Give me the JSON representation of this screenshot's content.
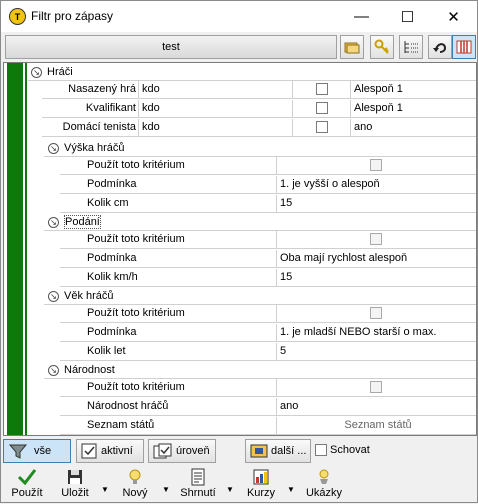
{
  "window": {
    "title": "Filtr pro zápasy",
    "minimize": "—",
    "maximize": "☐",
    "close": "✕"
  },
  "toolbar": {
    "filter_name": "test"
  },
  "grid": {
    "group_players": "Hráči",
    "rows_players": [
      {
        "label": "Nasazený hrá",
        "who": "kdo",
        "value": "Alespoň 1"
      },
      {
        "label": "Kvalifikant",
        "who": "kdo",
        "value": "Alespoň 1"
      },
      {
        "label": "Domácí tenista",
        "who": "kdo",
        "value": "ano"
      }
    ],
    "group_height": {
      "title": "Výška hráčů",
      "use_label": "Použít toto kritérium",
      "cond_label": "Podmínka",
      "cond_value": "1. je vyšší o alespoň",
      "count_label": "Kolik cm",
      "count_value": "15"
    },
    "group_serve": {
      "title": "Podání",
      "use_label": "Použít toto kritérium",
      "cond_label": "Podmínka",
      "cond_value": "Oba mají rychlost alespoň",
      "count_label": "Kolik km/h",
      "count_value": "15"
    },
    "group_age": {
      "title": "Věk hráčů",
      "use_label": "Použít toto kritérium",
      "cond_label": "Podmínka",
      "cond_value": "1. je mladší NEBO starší o max.",
      "count_label": "Kolik let",
      "count_value": "5"
    },
    "group_nat": {
      "title": "Národnost",
      "use_label": "Použít toto kritérium",
      "nat_label": "Národnost hráčů",
      "nat_value": "ano",
      "list_label": "Seznam států",
      "list_value": "Seznam států"
    }
  },
  "filterbar": {
    "all": "vše",
    "active": "aktivní",
    "level": "úroveň",
    "more": "další ...",
    "hide": "Schovat"
  },
  "actions": {
    "apply": "Použít",
    "save": "Uložit",
    "new": "Nový",
    "summary": "Shrnutí",
    "odds": "Kurzy",
    "examples": "Ukázky"
  },
  "colors": {
    "green": "#0b7a0b",
    "apply_check": "#1e8c1e"
  }
}
